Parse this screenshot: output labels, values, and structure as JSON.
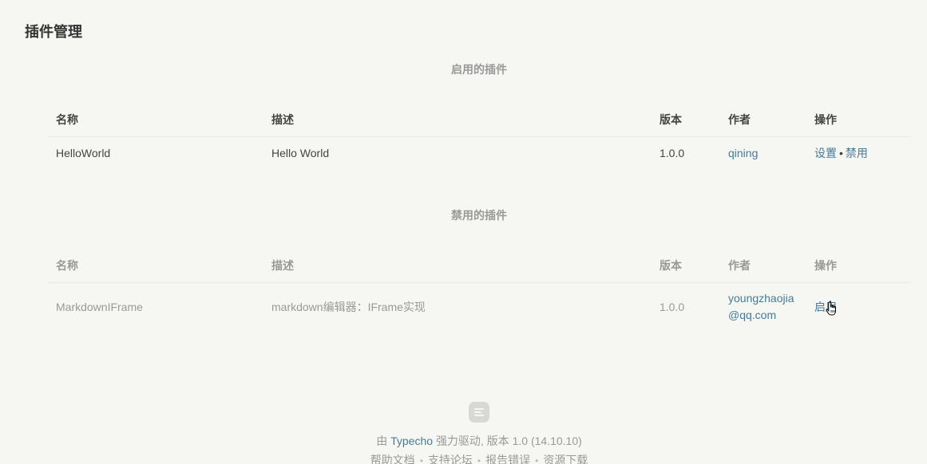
{
  "page": {
    "title": "插件管理"
  },
  "enabled_section": {
    "title": "启用的插件",
    "headers": {
      "name": "名称",
      "desc": "描述",
      "version": "版本",
      "author": "作者",
      "ops": "操作"
    },
    "plugins": [
      {
        "name": "HelloWorld",
        "desc": "Hello World",
        "version": "1.0.0",
        "author": "qining",
        "op1": "设置",
        "sep": "•",
        "op2": "禁用"
      }
    ]
  },
  "disabled_section": {
    "title": "禁用的插件",
    "headers": {
      "name": "名称",
      "desc": "描述",
      "version": "版本",
      "author": "作者",
      "ops": "操作"
    },
    "plugins": [
      {
        "name": "MarkdownIFrame",
        "desc": "markdown编辑器：IFrame实现",
        "version": "1.0.0",
        "author_line1": "youngzhaojia",
        "author_line2": "@qq.com",
        "op1": "启用"
      }
    ]
  },
  "footer": {
    "prefix": "由",
    "brand": "Typecho",
    "suffix": "强力驱动, 版本 1.0 (14.10.10)",
    "links": [
      "帮助文档",
      "支持论坛",
      "报告错误",
      "资源下载"
    ],
    "link_sep": "•"
  },
  "colors": {
    "link": "#467b96",
    "background": "#f6f6f3",
    "muted": "#999999"
  }
}
